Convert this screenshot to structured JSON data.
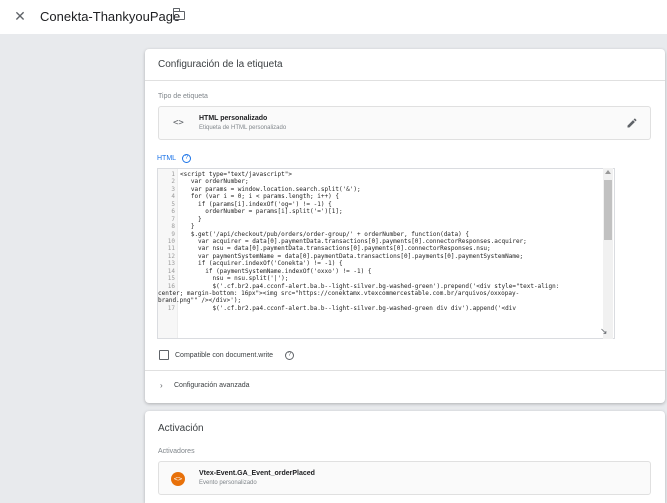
{
  "header": {
    "title": "Conekta-ThankyouPage",
    "close_icon": "close-icon",
    "folder_icon": "folder-icon"
  },
  "config_card": {
    "title": "Configuración de la etiqueta",
    "tag_type_label": "Tipo de etiqueta",
    "tag_type": {
      "name": "HTML personalizado",
      "subtitle": "Etiqueta de HTML personalizado",
      "icon": "code-icon"
    },
    "html_label": "HTML",
    "code": [
      {
        "n": "1",
        "t": "<script type=\"text/javascript\">"
      },
      {
        "n": "2",
        "t": "   var orderNumber;"
      },
      {
        "n": "3",
        "t": "   var params = window.location.search.split('&');"
      },
      {
        "n": "4",
        "t": "   for (var i = 0; i < params.length; i++) {"
      },
      {
        "n": "5",
        "t": "     if (params[i].indexOf('og=') != -1) {"
      },
      {
        "n": "6",
        "t": "       orderNumber = params[i].split('=')[1];"
      },
      {
        "n": "7",
        "t": "     }"
      },
      {
        "n": "8",
        "t": "   }"
      },
      {
        "n": "9",
        "t": "   $.get('/api/checkout/pub/orders/order-group/' + orderNumber, function(data) {"
      },
      {
        "n": "10",
        "t": "     var acquirer = data[0].paymentData.transactions[0].payments[0].connectorResponses.acquirer;"
      },
      {
        "n": "11",
        "t": "     var nsu = data[0].paymentData.transactions[0].payments[0].connectorResponses.nsu;"
      },
      {
        "n": "12",
        "t": "     var paymentSystemName = data[0].paymentData.transactions[0].payments[0].paymentSystemName;"
      },
      {
        "n": "13",
        "t": "     if (acquirer.indexOf('Conekta') != -1) {"
      },
      {
        "n": "14",
        "t": "       if (paymentSystemName.indexOf('oxxo') != -1) {"
      },
      {
        "n": "15",
        "t": "         nsu = nsu.split('|');"
      },
      {
        "n": "16",
        "t": "         $('.cf.br2.pa4.cconf-alert.ba.b--light-silver.bg-washed-green').prepend('<div style=\"text-align:"
      },
      {
        "n": "",
        "t": "center; margin-bottom: 16px\"><img src=\"https://conektamx.vtexcommercestable.com.br/arquivos/oxxopay-"
      },
      {
        "n": "",
        "t": "brand.png\"\" /></div>');"
      },
      {
        "n": "17",
        "t": "         $('.cf.br2.pa4.cconf-alert.ba.b--light-silver.bg-washed-green div div').append('<div"
      }
    ],
    "checkbox_label": "Compatible con document.write",
    "advanced_label": "Configuración avanzada"
  },
  "activation_card": {
    "title": "Activación",
    "triggers_label": "Activadores",
    "trigger": {
      "name": "Vtex-Event.GA_Event_orderPlaced",
      "subtitle": "Evento personalizado",
      "icon": "custom-event-icon",
      "color": "#e8710a"
    }
  }
}
